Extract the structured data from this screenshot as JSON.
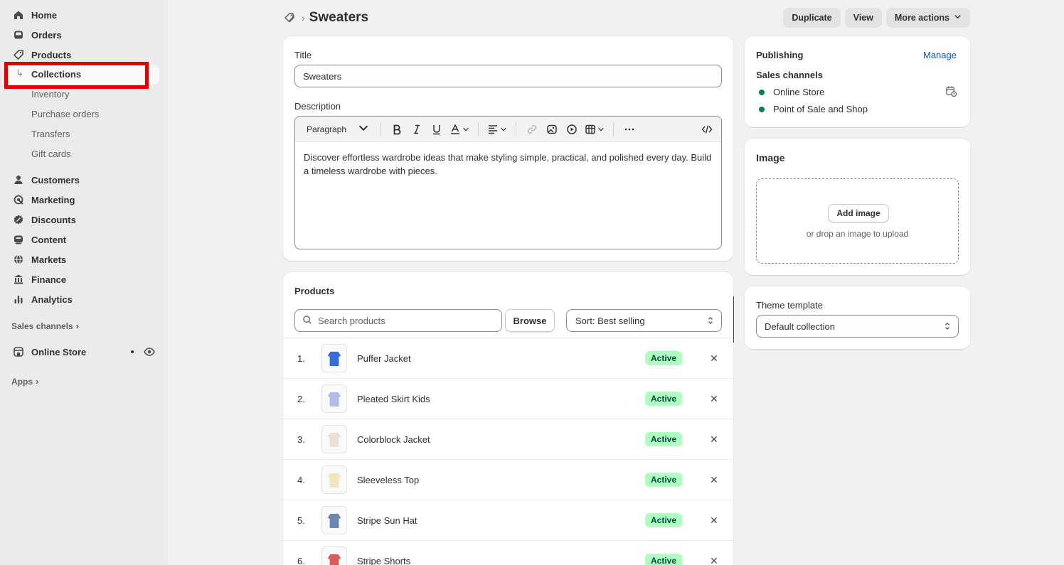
{
  "sidebar": {
    "main": [
      {
        "label": "Home",
        "icon": "home-icon"
      },
      {
        "label": "Orders",
        "icon": "inbox-icon"
      },
      {
        "label": "Products",
        "icon": "tag-icon"
      }
    ],
    "product_subitems": [
      "Collections",
      "Inventory",
      "Purchase orders",
      "Transfers",
      "Gift cards"
    ],
    "secondary": [
      {
        "label": "Customers",
        "icon": "person-icon"
      },
      {
        "label": "Marketing",
        "icon": "target-icon"
      },
      {
        "label": "Discounts",
        "icon": "discount-icon"
      },
      {
        "label": "Content",
        "icon": "content-icon"
      },
      {
        "label": "Markets",
        "icon": "globe-icon"
      },
      {
        "label": "Finance",
        "icon": "bank-icon"
      },
      {
        "label": "Analytics",
        "icon": "bar-chart-icon"
      }
    ],
    "sales_channels_label": "Sales channels",
    "online_store_label": "Online Store",
    "apps_label": "Apps"
  },
  "header": {
    "title": "Sweaters",
    "actions": [
      "Duplicate",
      "View",
      "More actions"
    ]
  },
  "details": {
    "title_label": "Title",
    "title_value": "Sweaters",
    "description_label": "Description",
    "paragraph_label": "Paragraph",
    "description_text": "Discover effortless wardrobe ideas that make styling simple, practical, and polished every day. Build a timeless wardrobe with pieces."
  },
  "products": {
    "heading": "Products",
    "search_placeholder": "Search products",
    "browse_label": "Browse",
    "sort_label": "Sort: Best selling",
    "items": [
      {
        "num": "1.",
        "name": "Puffer Jacket",
        "status": "Active",
        "color": "#1f5fd1"
      },
      {
        "num": "2.",
        "name": "Pleated Skirt Kids",
        "status": "Active",
        "color": "#a9b4e6"
      },
      {
        "num": "3.",
        "name": "Colorblock Jacket",
        "status": "Active",
        "color": "#e8ddd2"
      },
      {
        "num": "4.",
        "name": "Sleeveless Top",
        "status": "Active",
        "color": "#f3e2b6"
      },
      {
        "num": "5.",
        "name": "Stripe Sun Hat",
        "status": "Active",
        "color": "#5f78a8"
      },
      {
        "num": "6.",
        "name": "Stripe Shorts",
        "status": "Active",
        "color": "#d44a4a"
      }
    ]
  },
  "publishing": {
    "heading": "Publishing",
    "manage_label": "Manage",
    "channels_label": "Sales channels",
    "channels": [
      "Online Store",
      "Point of Sale and Shop"
    ]
  },
  "image": {
    "heading": "Image",
    "add_label": "Add image",
    "hint": "or drop an image to upload"
  },
  "theme": {
    "label": "Theme template",
    "value": "Default collection"
  }
}
